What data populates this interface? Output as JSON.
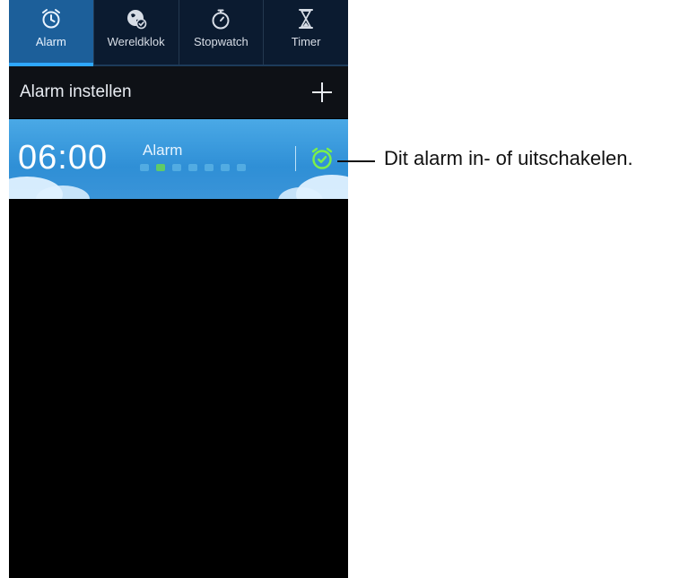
{
  "tabs": [
    {
      "label": "Alarm",
      "icon": "alarm-clock-icon",
      "active": true
    },
    {
      "label": "Wereldklok",
      "icon": "globe-icon",
      "active": false
    },
    {
      "label": "Stopwatch",
      "icon": "stopwatch-icon",
      "active": false
    },
    {
      "label": "Timer",
      "icon": "hourglass-icon",
      "active": false
    }
  ],
  "header": {
    "title": "Alarm instellen",
    "add_icon": "plus-icon"
  },
  "alarm": {
    "time": "06:00",
    "name": "Alarm",
    "days_active": [
      false,
      true,
      false,
      false,
      false,
      false,
      false
    ],
    "toggle_icon": "alarm-clock-icon",
    "toggle_color": "#7cf04a"
  },
  "callout": {
    "text": "Dit alarm in- of uitschakelen."
  },
  "colors": {
    "tab_active": "#1c5f9a",
    "alarm_bg": "#3a94d8",
    "phone_bg": "#000000"
  }
}
